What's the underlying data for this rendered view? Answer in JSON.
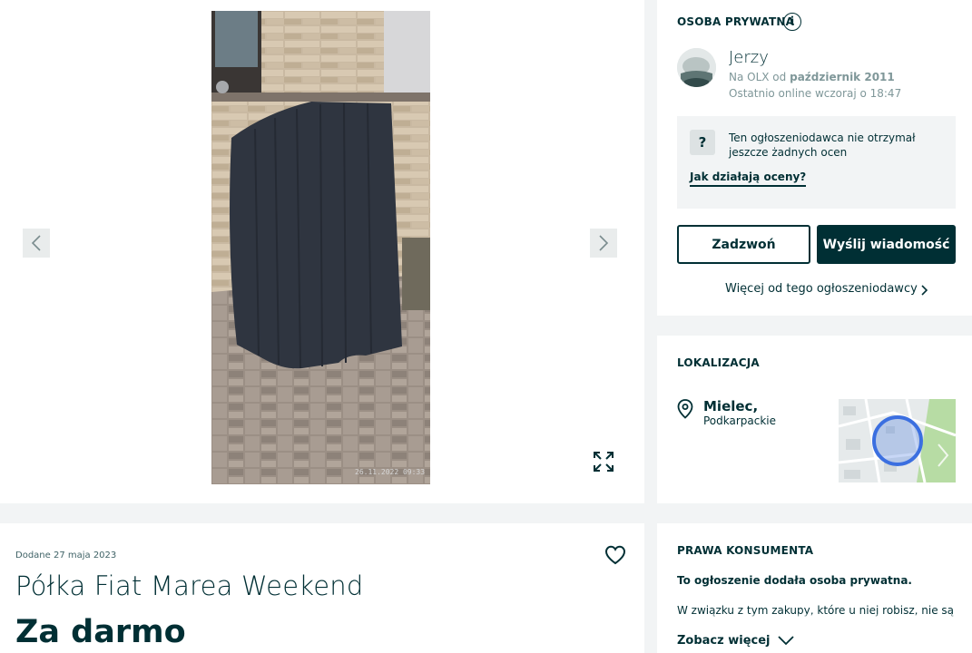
{
  "seller": {
    "section_title": "OSOBA PRYWATNA",
    "name": "Jerzy",
    "since_prefix": "Na OLX od",
    "since_date": "październik 2011",
    "last_online": "Ostatnio online wczoraj o 18:47",
    "ratings_notice": "Ten ogłoszeniodawca nie otrzymał jeszcze żadnych ocen",
    "ratings_badge": "?",
    "ratings_link": "Jak działają oceny?",
    "call_button": "Zadzwoń",
    "message_button": "Wyślij wiadomość",
    "more_link": "Więcej od tego ogłoszeniodawcy"
  },
  "location": {
    "section_title": "LOKALIZACJA",
    "city": "Mielec,",
    "region": "Podkarpackie"
  },
  "ad": {
    "added": "Dodane 27 maja 2023",
    "title": "Półka Fiat Marea Weekend",
    "price": "Za darmo",
    "photo_timestamp": "26.11.2022  09:33"
  },
  "consumer_rights": {
    "section_title": "PRAWA KONSUMENTA",
    "subtitle": "To ogłoszenie dodała osoba prywatna.",
    "text": "W związku z tym zakupy, które u niej robisz, nie są",
    "see_more": "Zobacz więcej"
  },
  "icons": {
    "prev": "chevron-left-icon",
    "next": "chevron-right-icon",
    "fullscreen": "expand-icon",
    "favorite": "heart-icon",
    "location": "pin-icon"
  },
  "colors": {
    "brand_dark": "#002f34",
    "muted": "#7f9799",
    "background": "#f2f4f5",
    "map_marker": "#3b6fe0"
  }
}
